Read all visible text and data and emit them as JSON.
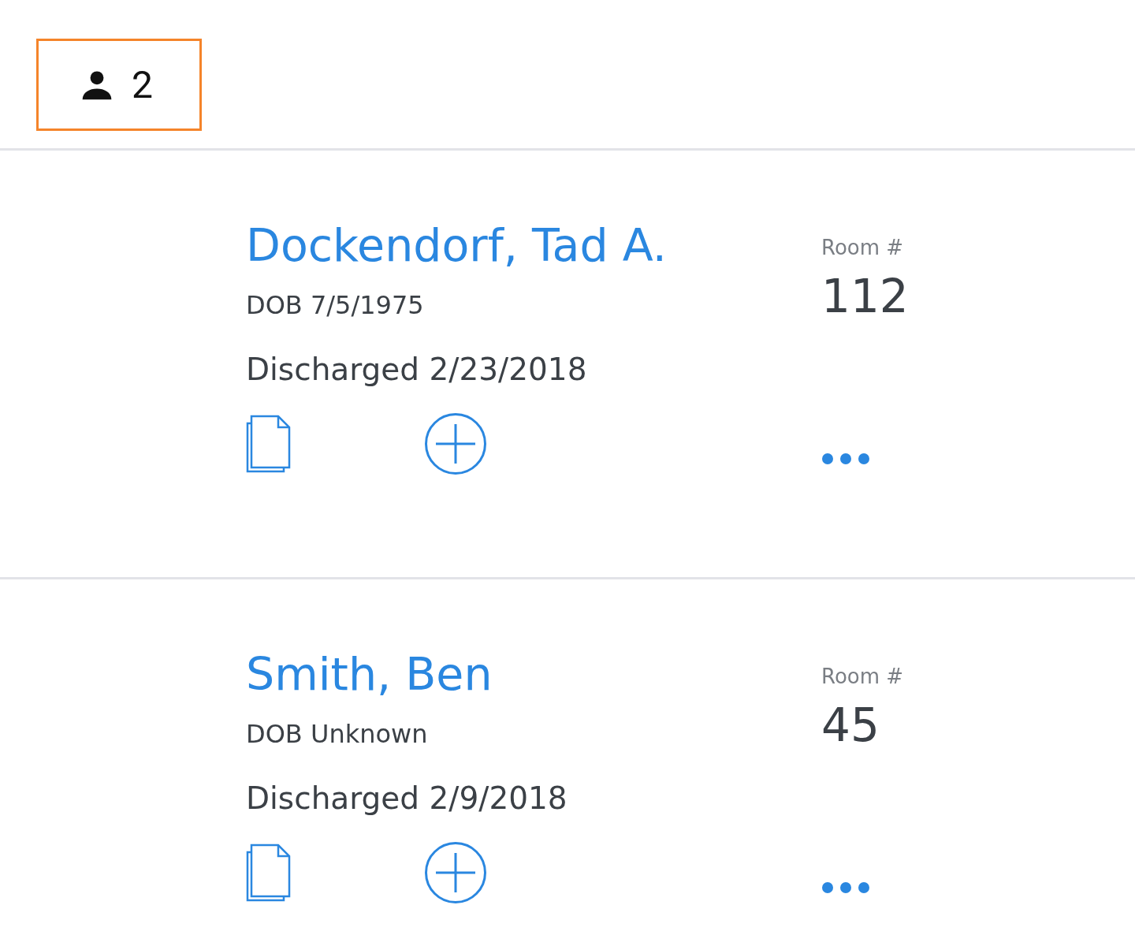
{
  "patient_count": {
    "count": "2",
    "selected": true
  },
  "patients": [
    {
      "name": "Dockendorf, Tad A.",
      "dob": "DOB 7/5/1975",
      "discharged": "Discharged 2/23/2018",
      "room_label": "Room #",
      "room": "112"
    },
    {
      "name": "Smith, Ben",
      "dob": "DOB Unknown",
      "discharged": "Discharged 2/9/2018",
      "room_label": "Room #",
      "room": "45"
    }
  ]
}
